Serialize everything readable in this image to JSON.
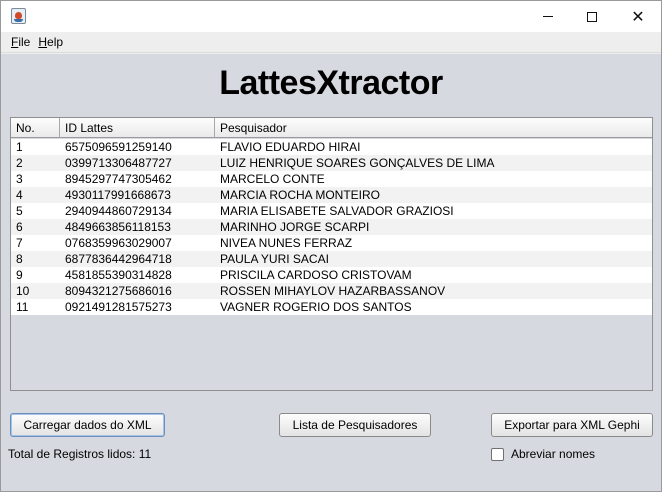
{
  "window": {
    "title": "",
    "controls": {
      "minimize": "minimize",
      "maximize": "maximize",
      "close": "close"
    }
  },
  "menu": {
    "items": [
      {
        "mnemonic": "F",
        "rest": "ile"
      },
      {
        "mnemonic": "H",
        "rest": "elp"
      }
    ]
  },
  "header": {
    "title": "LattesXtractor"
  },
  "table": {
    "columns": [
      "No.",
      "ID Lattes",
      "Pesquisador"
    ],
    "rows": [
      [
        "1",
        "6575096591259140",
        "FLAVIO EDUARDO HIRAI"
      ],
      [
        "2",
        "0399713306487727",
        "LUIZ HENRIQUE SOARES GONÇALVES DE LIMA"
      ],
      [
        "3",
        "8945297747305462",
        "MARCELO CONTE"
      ],
      [
        "4",
        "4930117991668673",
        "MARCIA ROCHA MONTEIRO"
      ],
      [
        "5",
        "2940944860729134",
        "MARIA ELISABETE SALVADOR GRAZIOSI"
      ],
      [
        "6",
        "4849663856118153",
        "MARINHO JORGE SCARPI"
      ],
      [
        "7",
        "0768359963029007",
        "NIVEA NUNES FERRAZ"
      ],
      [
        "8",
        "6877836442964718",
        "PAULA YURI SACAI"
      ],
      [
        "9",
        "4581855390314828",
        "PRISCILA CARDOSO CRISTOVAM"
      ],
      [
        "10",
        "8094321275686016",
        "ROSSEN MIHAYLOV HAZARBASSANOV"
      ],
      [
        "11",
        "0921491281575273",
        "VAGNER ROGERIO DOS SANTOS"
      ]
    ]
  },
  "buttons": {
    "load": "Carregar dados do XML",
    "list": "Lista de Pesquisadores",
    "export": "Exportar para XML Gephi"
  },
  "status": {
    "text": "Total de Registros lidos: 11"
  },
  "options": {
    "abbreviate_label": "Abreviar nomes",
    "abbreviate_checked": false
  }
}
